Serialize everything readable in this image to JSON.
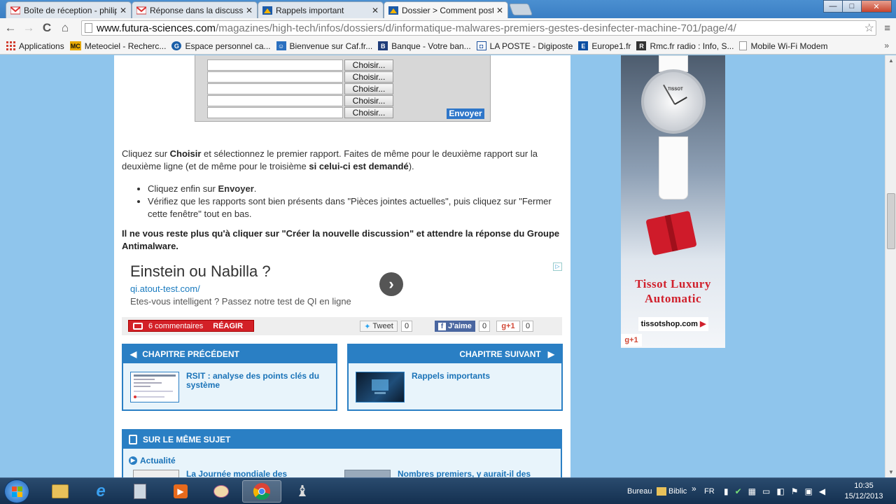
{
  "tabs": [
    {
      "title": "Boîte de réception - philip",
      "icon": "gmail-icon"
    },
    {
      "title": "Réponse dans la discussio",
      "icon": "gmail-icon"
    },
    {
      "title": "Rappels important",
      "icon": "futura-icon"
    },
    {
      "title": "Dossier > Comment poste",
      "icon": "futura-icon",
      "active": true
    }
  ],
  "window": {
    "minimize": "—",
    "maximize": "□",
    "close": "✕"
  },
  "toolbar": {
    "back": "←",
    "forward": "→",
    "reload": "C",
    "home": "⌂",
    "url_domain": "www.futura-sciences.com",
    "url_path": "/magazines/high-tech/infos/dossiers/d/informatique-malwares-premiers-gestes-desinfecter-machine-701/page/4/",
    "star": "☆",
    "menu": "≡"
  },
  "bookmarks": [
    {
      "label": "Applications",
      "icon": "apps-grid-icon",
      "color": "#d23f31"
    },
    {
      "label": "Meteociel - Recherc...",
      "icon": "mc-icon",
      "color": "#e8a900"
    },
    {
      "label": "Espace personnel ca...",
      "icon": "caf-icon",
      "color": "#1b5fa8"
    },
    {
      "label": "Bienvenue sur Caf.fr...",
      "icon": "caf-people-icon",
      "color": "#2a6fbf"
    },
    {
      "label": "Banque - Votre ban...",
      "icon": "banque-icon",
      "color": "#1f3d7a"
    },
    {
      "label": "LA POSTE - Digiposte",
      "icon": "laposte-icon",
      "color": "#1a4f9c"
    },
    {
      "label": "Europe1.fr",
      "icon": "europe1-icon",
      "color": "#0b4ea2"
    },
    {
      "label": "Rmc.fr radio : Info, S...",
      "icon": "rmc-icon",
      "color": "#333333"
    },
    {
      "label": "Mobile Wi-Fi Modem",
      "icon": "page-icon",
      "color": "#ffffff"
    }
  ],
  "bookmarks_more": "»",
  "form": {
    "choose_label": "Choisir...",
    "rows": 5,
    "send_label": "Envoyer"
  },
  "article": {
    "p1_a": "Cliquez sur ",
    "p1_b": "Choisir",
    "p1_c": " et sélectionnez le premier rapport. Faites de même pour le deuxième rapport sur la deuxième ligne (et de même pour le troisième ",
    "p1_d": "si celui-ci est demandé",
    "p1_e": ").",
    "li1_a": "Cliquez enfin sur ",
    "li1_b": "Envoyer",
    "li1_c": ".",
    "li2": "Vérifiez que les rapports sont bien présents dans \"Pièces jointes actuelles\", puis cliquez sur \"Fermer cette fenêtre\" tout en bas.",
    "p2": "Il ne vous reste plus qu'à cliquer sur \"Créer la nouvelle discussion\" et attendre la réponse du Groupe Antimalware."
  },
  "ad": {
    "title": "Einstein ou Nabilla ?",
    "url": "qi.atout-test.com/",
    "desc": "Etes-vous intelligent ? Passez notre test de QI en ligne",
    "arrow": "›",
    "choices": "▷"
  },
  "share": {
    "comments": "6 commentaires",
    "react": "RÉAGIR",
    "tweet": "Tweet",
    "tweet_count": "0",
    "like": "J'aime",
    "like_count": "0",
    "gplus": "g+1",
    "gplus_count": "0"
  },
  "chapters": {
    "prev_head": "CHAPITRE PRÉCÉDENT",
    "prev_link": "RSIT : analyse des points clés du système",
    "next_head": "CHAPITRE SUIVANT",
    "next_link": "Rappels importants"
  },
  "same_subject": {
    "head": "SUR LE MÊME SUJET",
    "actu": "Actualité",
    "item1": "La Journée mondiale des",
    "item2": "Nombres premiers, y aurait-il des"
  },
  "side_ad": {
    "brand_line1": "Tissot Luxury",
    "brand_line2": "Automatic",
    "shop": "tissotshop.com",
    "shop_arrow": "▶",
    "gplus": "g+1",
    "accent": "#d0202c"
  },
  "taskbar": {
    "bureau": "Bureau",
    "biblio": "Biblic",
    "more": "»",
    "lang": "FR",
    "time": "10:35",
    "date": "15/12/2013"
  }
}
